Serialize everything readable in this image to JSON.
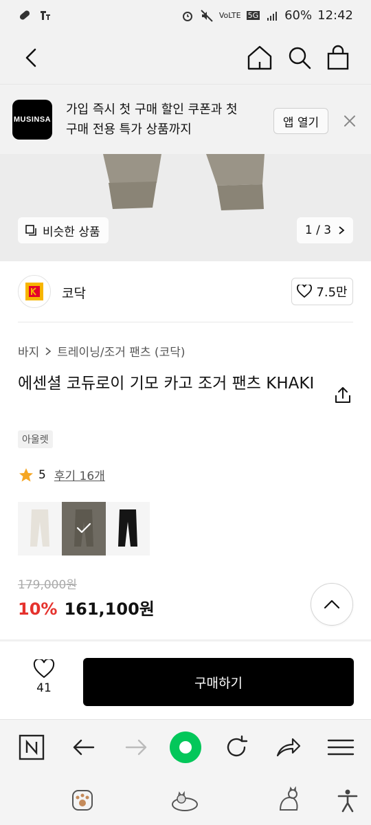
{
  "status_bar": {
    "battery": "60%",
    "time": "12:42",
    "network": "5G"
  },
  "promo": {
    "logo_text": "MUSINSA",
    "message_line1": "가입 즉시 첫 구매 할인 쿠폰과 첫",
    "message_line2": "구매 전용 특가 상품까지",
    "open_app_label": "앱 열기"
  },
  "hero": {
    "similar_label": "비슷한 상품",
    "pager": "1 / 3"
  },
  "brand": {
    "name": "코닥",
    "likes": "7.5만"
  },
  "product": {
    "category_root": "바지",
    "category_sub": "트레이닝/조거 팬츠 (코닥)",
    "title": "에센셜 코듀로이 기모 카고 조거 팬츠 KHAKI",
    "tag": "아울렛",
    "rating": "5",
    "reviews": "후기 16개",
    "original_price": "179,000원",
    "discount": "10%",
    "price": "161,100원",
    "colors": [
      "ivory",
      "khaki",
      "black"
    ],
    "selected_color_index": 1
  },
  "buy_bar": {
    "fav_count": "41",
    "buy_label": "구매하기"
  },
  "colors": {
    "accent_red": "#e5322d",
    "brand_black": "#000000",
    "rating_star": "#f5a623",
    "kodak_yellow": "#f7b500",
    "kodak_red": "#e4002b",
    "browser_green": "#03c75a"
  }
}
